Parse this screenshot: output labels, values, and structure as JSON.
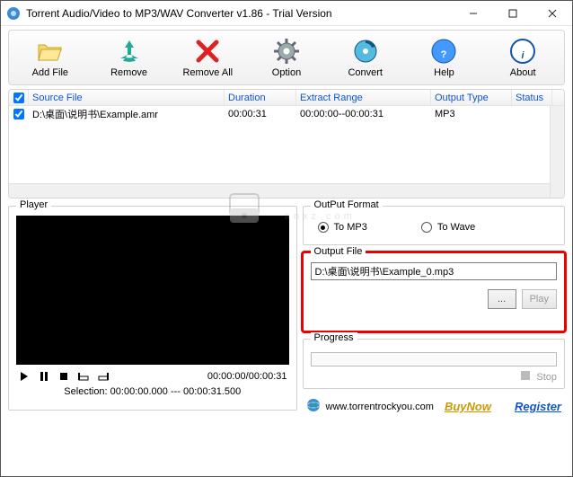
{
  "window": {
    "title": "Torrent Audio/Video to MP3/WAV Converter v1.86 - Trial Version"
  },
  "toolbar": {
    "add_file": "Add File",
    "remove": "Remove",
    "remove_all": "Remove All",
    "option": "Option",
    "convert": "Convert",
    "help": "Help",
    "about": "About"
  },
  "list": {
    "headers": {
      "source_file": "Source File",
      "duration": "Duration",
      "extract_range": "Extract Range",
      "output_type": "Output Type",
      "status": "Status"
    },
    "row": {
      "source": "D:\\桌面\\说明书\\Example.amr",
      "duration": "00:00:31",
      "extract": "00:00:00--00:00:31",
      "output": "MP3",
      "status": ""
    }
  },
  "player": {
    "title": "Player",
    "time": "00:00:00/00:00:31",
    "selection": "Selection: 00:00:00.000 --- 00:00:31.500"
  },
  "output_format": {
    "title": "OutPut Format",
    "to_mp3": "To MP3",
    "to_wave": "To Wave"
  },
  "output_file": {
    "title": "Output File",
    "path": "D:\\桌面\\说明书\\Example_0.mp3",
    "browse": "...",
    "play": "Play"
  },
  "progress": {
    "title": "Progress",
    "stop": "Stop"
  },
  "footer": {
    "url": "www.torrentrockyou.com",
    "buynow": "BuyNow",
    "register": "Register"
  },
  "watermark": "anxz.com"
}
